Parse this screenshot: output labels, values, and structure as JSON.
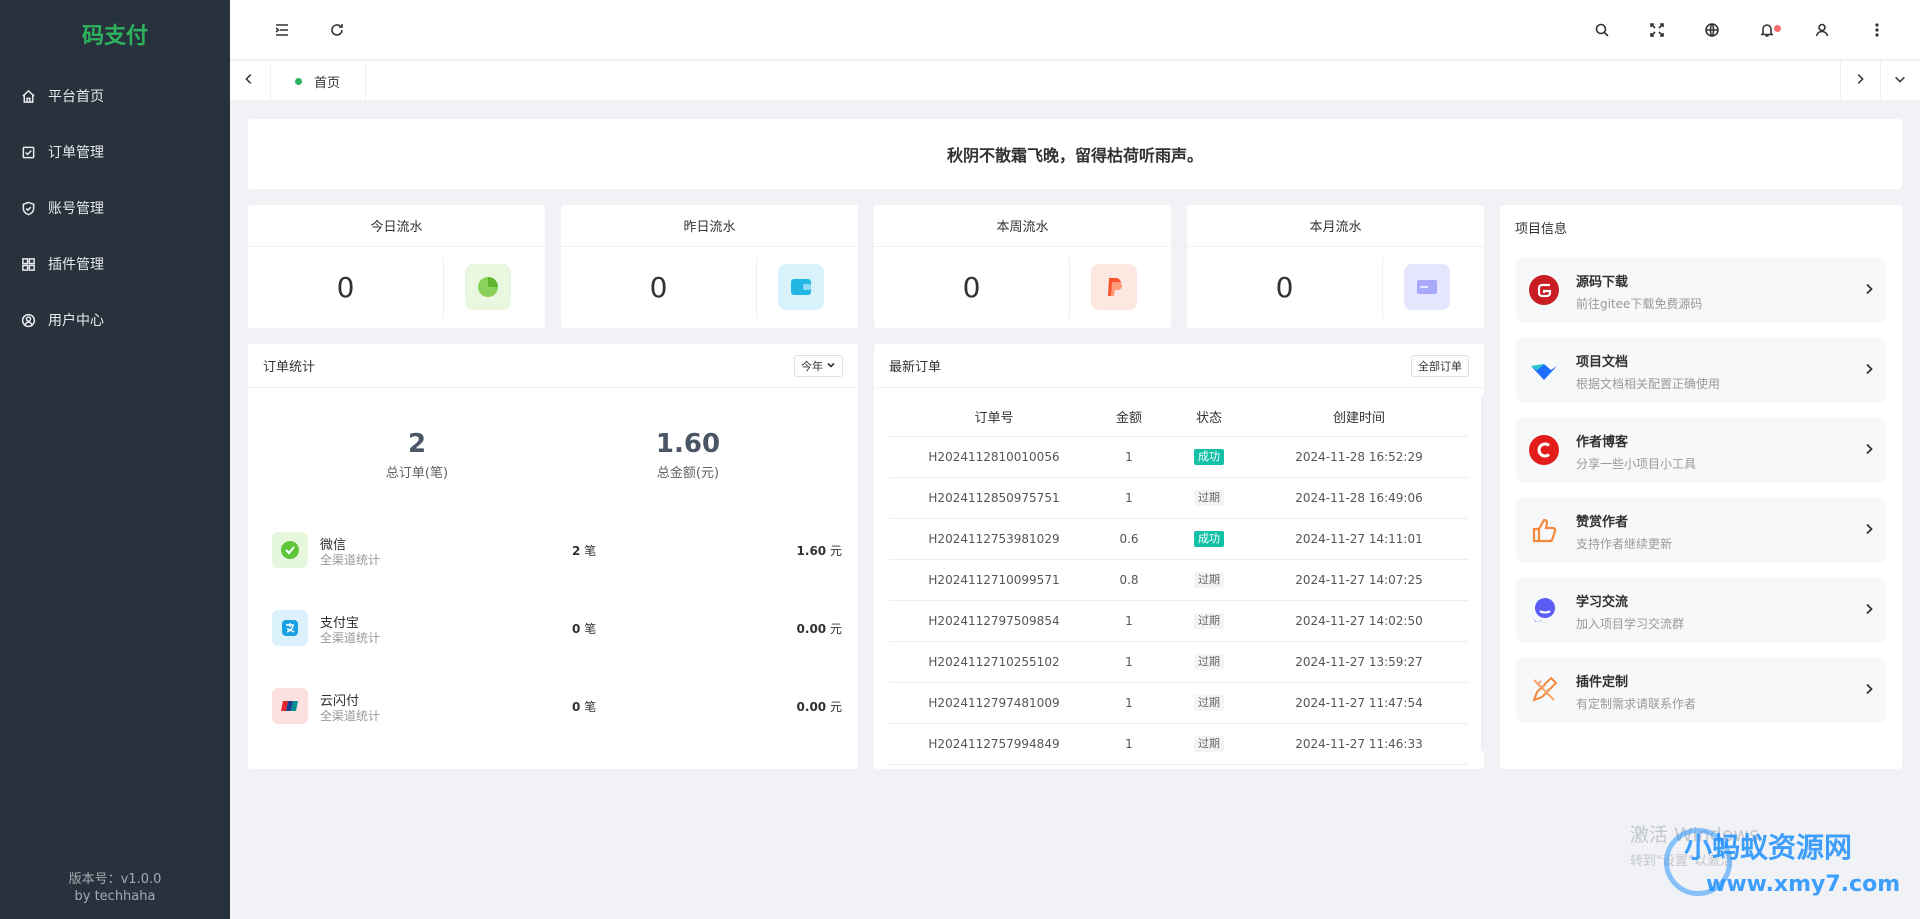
{
  "sidebar": {
    "logo": "码支付",
    "items": [
      {
        "label": "平台首页",
        "icon": "home-icon"
      },
      {
        "label": "订单管理",
        "icon": "checklist-icon"
      },
      {
        "label": "账号管理",
        "icon": "shield-icon"
      },
      {
        "label": "插件管理",
        "icon": "grid-icon"
      },
      {
        "label": "用户中心",
        "icon": "user-circle-icon"
      }
    ],
    "version": "版本号：v1.0.0",
    "author": "by techhaha"
  },
  "tabs": [
    {
      "label": "首页"
    }
  ],
  "quote": "秋阴不散霜飞晚，留得枯荷听雨声。",
  "stats": [
    {
      "title": "今日流水",
      "value": "0",
      "icon": "pie-chart-icon",
      "color": "#7cc94d"
    },
    {
      "title": "昨日流水",
      "value": "0",
      "icon": "wallet-icon",
      "color": "#23b7e5"
    },
    {
      "title": "本周流水",
      "value": "0",
      "icon": "paypal-icon",
      "color": "#f5532d"
    },
    {
      "title": "本月流水",
      "value": "0",
      "icon": "card-icon",
      "color": "#8c8cff"
    }
  ],
  "orders": {
    "title": "订单统计",
    "filter": "今年",
    "total_orders": "2",
    "total_orders_label": "总订单(笔)",
    "total_amount": "1.60",
    "total_amount_label": "总金额(元)",
    "channels": [
      {
        "name": "微信",
        "sub": "全渠道统计",
        "count": "2",
        "count_unit": "笔",
        "amount": "1.60",
        "amount_unit": "元"
      },
      {
        "name": "支付宝",
        "sub": "全渠道统计",
        "count": "0",
        "count_unit": "笔",
        "amount": "0.00",
        "amount_unit": "元"
      },
      {
        "name": "云闪付",
        "sub": "全渠道统计",
        "count": "0",
        "count_unit": "笔",
        "amount": "0.00",
        "amount_unit": "元"
      }
    ]
  },
  "latest": {
    "title": "最新订单",
    "all_button": "全部订单",
    "columns": [
      "订单号",
      "金额",
      "状态",
      "创建时间"
    ],
    "rows": [
      {
        "no": "H2024112810010056",
        "amount": "1",
        "status": "成功",
        "ok": true,
        "time": "2024-11-28 16:52:29"
      },
      {
        "no": "H2024112850975751",
        "amount": "1",
        "status": "过期",
        "ok": false,
        "time": "2024-11-28 16:49:06"
      },
      {
        "no": "H2024112753981029",
        "amount": "0.6",
        "status": "成功",
        "ok": true,
        "time": "2024-11-27 14:11:01"
      },
      {
        "no": "H2024112710099571",
        "amount": "0.8",
        "status": "过期",
        "ok": false,
        "time": "2024-11-27 14:07:25"
      },
      {
        "no": "H2024112797509854",
        "amount": "1",
        "status": "过期",
        "ok": false,
        "time": "2024-11-27 14:02:50"
      },
      {
        "no": "H2024112710255102",
        "amount": "1",
        "status": "过期",
        "ok": false,
        "time": "2024-11-27 13:59:27"
      },
      {
        "no": "H2024112797481009",
        "amount": "1",
        "status": "过期",
        "ok": false,
        "time": "2024-11-27 11:47:54"
      },
      {
        "no": "H2024112757994849",
        "amount": "1",
        "status": "过期",
        "ok": false,
        "time": "2024-11-27 11:46:33"
      }
    ]
  },
  "project": {
    "title": "项目信息",
    "items": [
      {
        "title": "源码下载",
        "desc": "前往gitee下载免费源码",
        "icon": "gitee-icon"
      },
      {
        "title": "项目文档",
        "desc": "根据文档相关配置正确使用",
        "icon": "docs-icon"
      },
      {
        "title": "作者博客",
        "desc": "分享一些小项目小工具",
        "icon": "csdn-icon"
      },
      {
        "title": "赞赏作者",
        "desc": "支持作者继续更新",
        "icon": "thumbs-up-icon"
      },
      {
        "title": "学习交流",
        "desc": "加入项目学习交流群",
        "icon": "chat-icon"
      },
      {
        "title": "插件定制",
        "desc": "有定制需求请联系作者",
        "icon": "pencil-ruler-icon"
      }
    ]
  },
  "watermark": {
    "windows": "激活 Windows",
    "windows_sub": "转到\"设置\"以激活",
    "site_name": "小蚂蚁资源网",
    "site_url": "www.xmy7.com"
  },
  "colors": {
    "sidebar_bg": "#28323d",
    "brand_green": "#2db35d",
    "success": "#13c2a6"
  }
}
